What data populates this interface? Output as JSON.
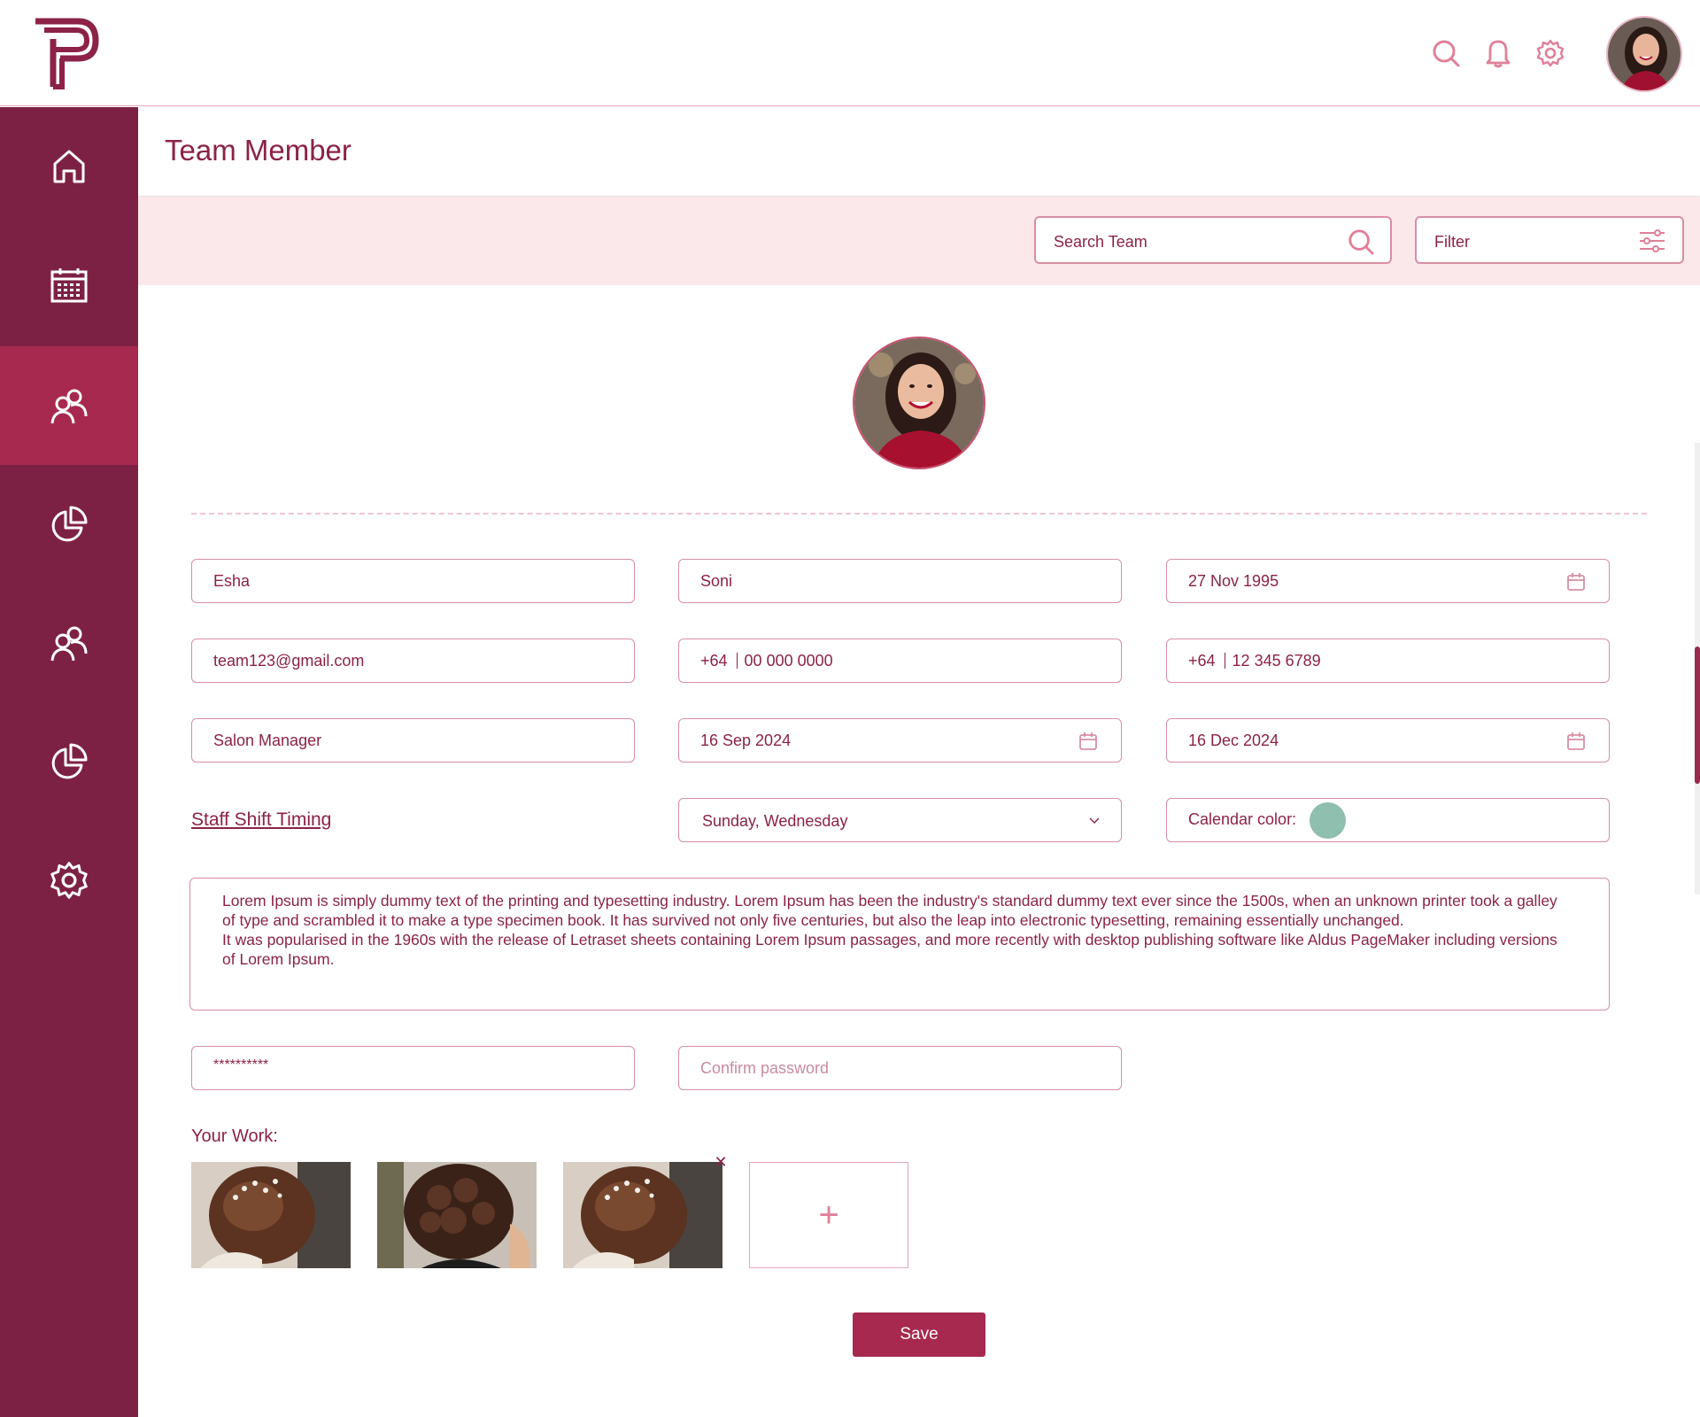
{
  "header": {
    "title": "Team Member"
  },
  "search": {
    "label": "Search Team"
  },
  "filter": {
    "label": "Filter"
  },
  "form": {
    "first_name": "Esha",
    "last_name": "Soni",
    "dob": "27 Nov 1995",
    "email": "team123@gmail.com",
    "phone1_code": "+64",
    "phone1_number": "00 000 0000",
    "phone2_code": "+64",
    "phone2_number": "12 345 6789",
    "role": "Salon Manager",
    "start_date": "16 Sep 2024",
    "end_date": "16 Dec 2024",
    "shift_link": "Staff Shift Timing",
    "days": "Sunday, Wednesday",
    "calendar_color_label": "Calendar color:",
    "calendar_color": "#8fbfae",
    "bio_p1": "Lorem Ipsum is simply dummy text of the printing and typesetting industry. Lorem Ipsum has been the industry's standard dummy text ever since the 1500s, when an unknown printer took a galley of type and scrambled it to make a type specimen book. It has survived not only five centuries, but also the leap into electronic typesetting, remaining essentially unchanged.",
    "bio_p2": "It was popularised in the 1960s with the release of Letraset sheets containing Lorem Ipsum passages, and more recently with desktop publishing software like Aldus PageMaker including versions of Lorem Ipsum.",
    "password": "**********",
    "confirm_password_placeholder": "Confirm password"
  },
  "work": {
    "label": "Your Work:",
    "remove": "✕",
    "add": "+"
  },
  "actions": {
    "save": "Save"
  },
  "sidebar": {
    "items": [
      {
        "icon": "home-icon"
      },
      {
        "icon": "calendar-icon"
      },
      {
        "icon": "team-icon",
        "active": true
      },
      {
        "icon": "pie-chart-icon"
      },
      {
        "icon": "users-icon"
      },
      {
        "icon": "pie-chart-icon"
      },
      {
        "icon": "gear-icon"
      }
    ]
  },
  "colors": {
    "primary": "#8c2247",
    "sidebar": "#7d2144",
    "active": "#a72950",
    "band": "#fbe8ea",
    "border": "#d98ea4"
  }
}
